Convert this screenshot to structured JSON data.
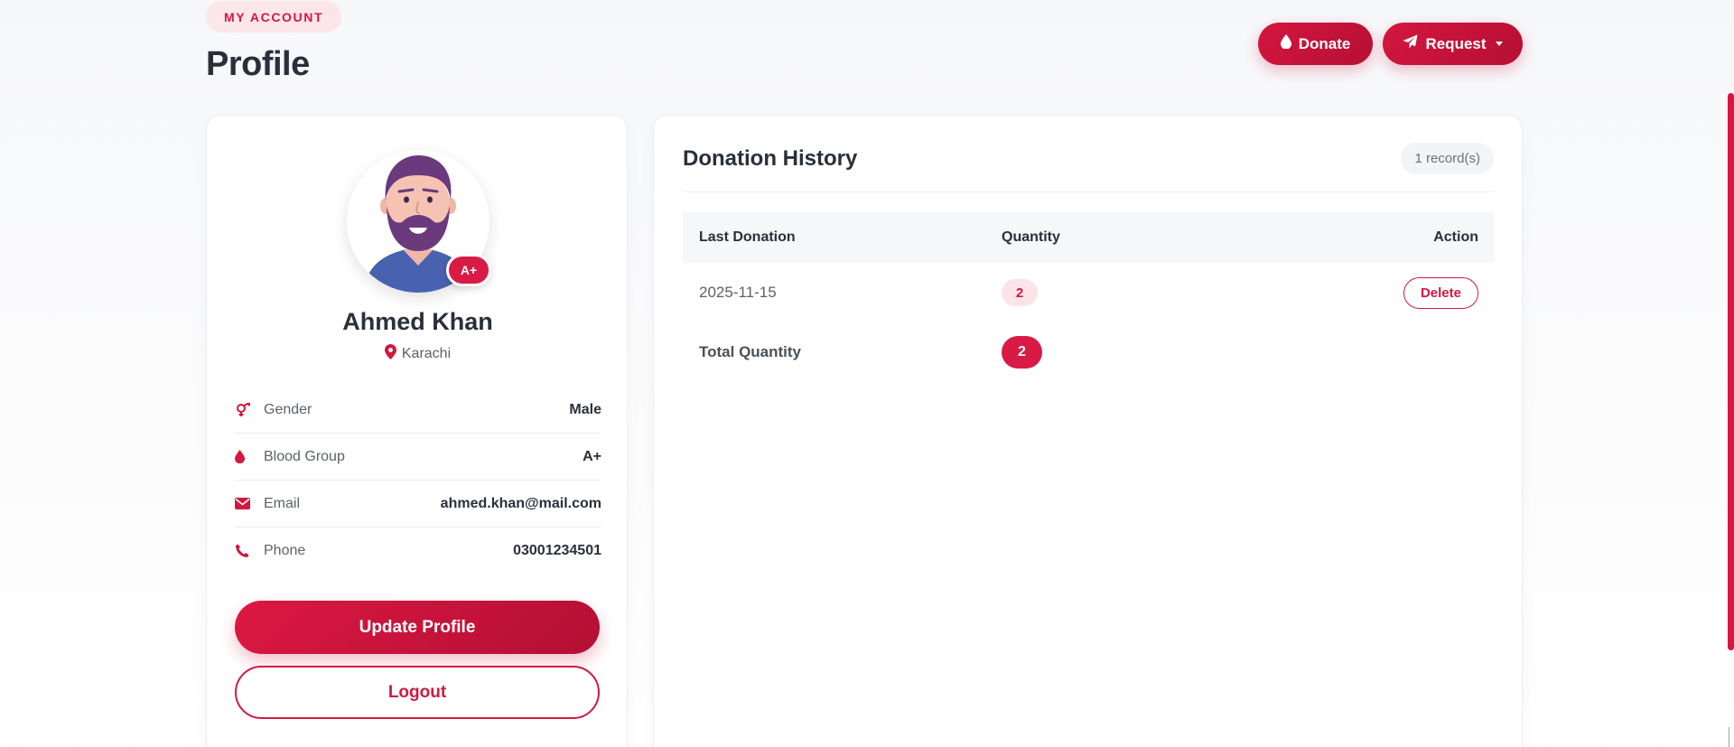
{
  "header": {
    "eyebrow": "MY ACCOUNT",
    "title": "Profile",
    "donate_label": "Donate",
    "request_label": "Request"
  },
  "profile": {
    "name": "Ahmed Khan",
    "location": "Karachi",
    "blood_badge": "A+",
    "info": [
      {
        "icon": "gender-icon",
        "label": "Gender",
        "value": "Male"
      },
      {
        "icon": "blood-drop-icon",
        "label": "Blood Group",
        "value": "A+"
      },
      {
        "icon": "envelope-icon",
        "label": "Email",
        "value": "ahmed.khan@mail.com"
      },
      {
        "icon": "phone-icon",
        "label": "Phone",
        "value": "03001234501"
      }
    ],
    "update_label": "Update Profile",
    "logout_label": "Logout"
  },
  "history": {
    "title": "Donation History",
    "record_count": "1 record(s)",
    "columns": [
      "Last Donation",
      "Quantity",
      "Action"
    ],
    "rows": [
      {
        "date": "2025-11-15",
        "quantity": "2",
        "action": "Delete"
      }
    ],
    "total_label": "Total Quantity",
    "total_value": "2"
  },
  "colors": {
    "accent": "#d81b45",
    "accent_dark": "#b60f33",
    "accent_soft": "#fbe4e9",
    "text": "#2a2f3a"
  }
}
